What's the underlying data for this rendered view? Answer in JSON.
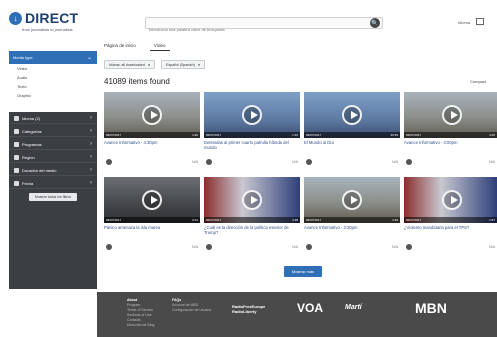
{
  "header": {
    "logo_text": "DIRECT",
    "logo_sub": "from journalists to journalists",
    "search_placeholder": "Introduzca una palabra clave de búsqueda",
    "language": "Idioma"
  },
  "tabs": [
    {
      "label": "Página de inicio"
    },
    {
      "label": "Vídeo"
    }
  ],
  "sidebar": {
    "top_label": "Media type",
    "sub_items": [
      "Video",
      "Audio",
      "Texto",
      "Graphic"
    ],
    "items": [
      {
        "label": "Idioma (2)"
      },
      {
        "label": "Categorías"
      },
      {
        "label": "Programas"
      },
      {
        "label": "Región"
      },
      {
        "label": "Duración del medio"
      },
      {
        "label": "Fecha"
      }
    ],
    "more_button": "Mostrar todos los filtros"
  },
  "filters": [
    "Idioma: all downloaded",
    "Español (Spanish)"
  ],
  "results": {
    "count_label": "41089 items found",
    "compact_label": "Compact"
  },
  "cards": [
    {
      "date": "06/07/2017",
      "duration": "4:30",
      "title": "Avance Informativo - 4:30pm",
      "na": "N/A"
    },
    {
      "date": "06/07/2017",
      "duration": "1:46",
      "title": "Detenidas al primer cuarto patrulla híbrida del mundo",
      "na": "N/A"
    },
    {
      "date": "06/07/2017",
      "duration": "30:59",
      "title": "El Mundo al Día",
      "na": "N/A"
    },
    {
      "date": "06/07/2017",
      "duration": "4:05",
      "title": "Avance Informativo - 4:00pm",
      "na": "N/A"
    },
    {
      "date": "06/07/2017",
      "duration": "2:41",
      "title": "Pánico amenaza la isla marea",
      "na": "N/A"
    },
    {
      "date": "06/07/2017",
      "duration": "4:38",
      "title": "¿Cuál es la dirección de la política exterior de Trump?",
      "na": "N/A"
    },
    {
      "date": "06/07/2017",
      "duration": "4:30",
      "title": "Avance Informativo - 3:30pm",
      "na": "N/A"
    },
    {
      "date": "06/07/2017",
      "duration": "1:57",
      "title": "¿Violento mandataria para el TPS?",
      "na": "N/A"
    }
  ],
  "show_more": "Mostrar más",
  "footer": {
    "col1_head": "About",
    "col1": [
      "Program",
      "Terms of Service",
      "Sections of Use",
      "Contacts",
      "Dirección de Blog"
    ],
    "col2_head": "FAQs",
    "col2": [
      "Account de MBD",
      "Configuración de Usuario"
    ],
    "logos": [
      "RadioFreeEurope RadioLiberty",
      "VOA",
      "Martí",
      "MBN"
    ]
  }
}
